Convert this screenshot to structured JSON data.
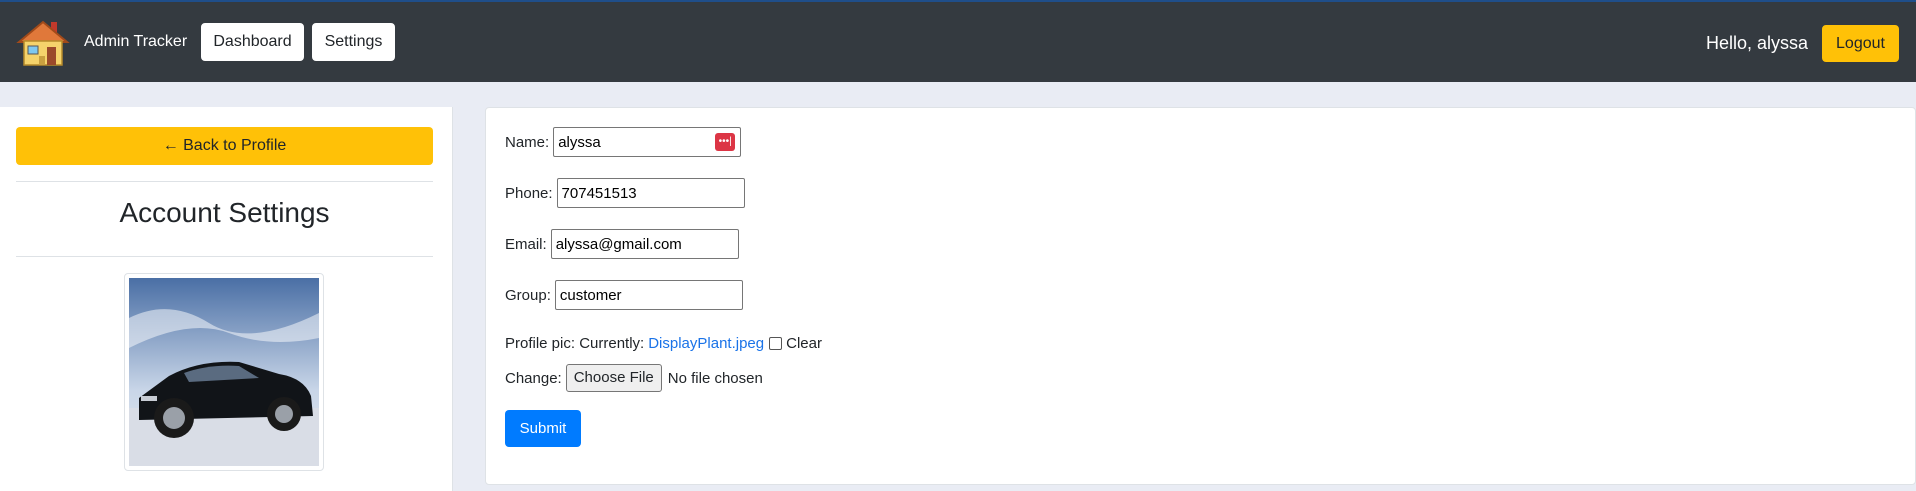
{
  "navbar": {
    "brand": "Admin Tracker",
    "nav_items": [
      {
        "label": "Dashboard"
      },
      {
        "label": "Settings"
      }
    ],
    "greeting": "Hello, alyssa",
    "logout_label": "Logout",
    "logo_icon": "house-icon"
  },
  "sidebar": {
    "back_label": "← Back to Profile",
    "title": "Account Settings",
    "profile_image": "car-photo"
  },
  "form": {
    "name_label": "Name:",
    "name_value": "alyssa",
    "phone_label": "Phone:",
    "phone_value": "707451513",
    "email_label": "Email:",
    "email_value": "alyssa@gmail.com",
    "group_label": "Group:",
    "group_value": "customer",
    "profile_pic_label": "Profile pic: Currently:",
    "current_file": "DisplayPlant.jpeg",
    "clear_label": "Clear",
    "change_label": "Change:",
    "choose_file_label": "Choose File",
    "no_file_text": "No file chosen",
    "submit_label": "Submit",
    "password_manager_icon": "password-manager-icon"
  },
  "colors": {
    "navbar_bg": "#343a40",
    "accent_yellow": "#ffc107",
    "primary_blue": "#007bff",
    "page_bg": "#e9ecf4"
  }
}
